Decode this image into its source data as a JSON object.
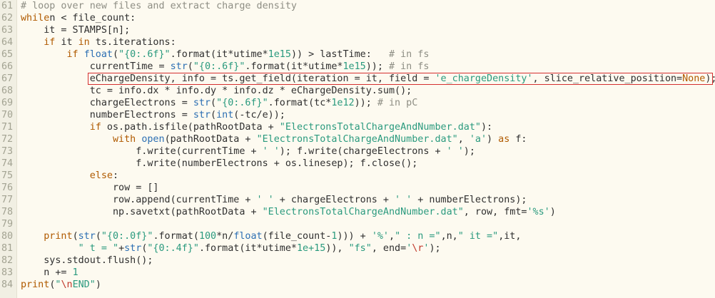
{
  "lines": [
    {
      "n": "61",
      "t": [
        [
          "cm",
          "# loop over new files and extract charge density"
        ]
      ]
    },
    {
      "n": "62",
      "t": [
        [
          "kw",
          "while"
        ],
        [
          "",
          "n < file_count:"
        ]
      ]
    },
    {
      "n": "63",
      "t": [
        [
          "",
          "    it = STAMPS[n];"
        ]
      ]
    },
    {
      "n": "64",
      "t": [
        [
          "",
          "    "
        ],
        [
          "kw",
          "if"
        ],
        [
          "",
          " it "
        ],
        [
          "kw",
          "in"
        ],
        [
          "",
          " ts.iterations:"
        ]
      ]
    },
    {
      "n": "65",
      "t": [
        [
          "",
          "        "
        ],
        [
          "kw",
          "if"
        ],
        [
          "",
          " "
        ],
        [
          "bi",
          "float"
        ],
        [
          "",
          "("
        ],
        [
          "str",
          "\"{0:.6f}\""
        ],
        [
          "",
          ".format(it*utime*"
        ],
        [
          "num",
          "1e15"
        ],
        [
          "",
          "))"
        ],
        [
          "",
          " > lastTime:   "
        ],
        [
          "cm",
          "# in fs"
        ]
      ]
    },
    {
      "n": "66",
      "t": [
        [
          "",
          "            currentTime = "
        ],
        [
          "bi",
          "str"
        ],
        [
          "",
          "("
        ],
        [
          "str",
          "\"{0:.6f}\""
        ],
        [
          "",
          ".format(it*utime*"
        ],
        [
          "num",
          "1e15"
        ],
        [
          "",
          "));"
        ],
        [
          "",
          " "
        ],
        [
          "cm",
          "# in fs"
        ]
      ]
    },
    {
      "n": "67",
      "t": [
        [
          "",
          "            eChargeDensity, info = ts.get_field(iteration = it, field = "
        ],
        [
          "str",
          "'e_chargeDensity'"
        ],
        [
          "",
          ", slice_relative_position="
        ],
        [
          "kw",
          "None"
        ],
        [
          "",
          ");"
        ]
      ],
      "highlight": true
    },
    {
      "n": "68",
      "t": [
        [
          "",
          "            tc = info.dx * info.dy * info.dz * eChargeDensity.sum();"
        ]
      ]
    },
    {
      "n": "69",
      "t": [
        [
          "",
          "            chargeElectrons = "
        ],
        [
          "bi",
          "str"
        ],
        [
          "",
          "("
        ],
        [
          "str",
          "\"{0:.6f}\""
        ],
        [
          "",
          ".format(tc*"
        ],
        [
          "num",
          "1e12"
        ],
        [
          "",
          "));"
        ],
        [
          "",
          " "
        ],
        [
          "cm",
          "# in pC"
        ]
      ]
    },
    {
      "n": "70",
      "t": [
        [
          "",
          "            numberElectrons = "
        ],
        [
          "bi",
          "str"
        ],
        [
          "",
          "("
        ],
        [
          "bi",
          "int"
        ],
        [
          "",
          "(-tc/e));"
        ]
      ]
    },
    {
      "n": "71",
      "t": [
        [
          "",
          "            "
        ],
        [
          "kw",
          "if"
        ],
        [
          "",
          " os.path.isfile(pathRootData + "
        ],
        [
          "str",
          "\"ElectronsTotalChargeAndNumber.dat\""
        ],
        [
          "",
          "):"
        ]
      ]
    },
    {
      "n": "72",
      "t": [
        [
          "",
          "                "
        ],
        [
          "kw",
          "with"
        ],
        [
          "",
          " "
        ],
        [
          "bi",
          "open"
        ],
        [
          "",
          "(pathRootData + "
        ],
        [
          "str",
          "\"ElectronsTotalChargeAndNumber.dat\""
        ],
        [
          "",
          ", "
        ],
        [
          "str",
          "'a'"
        ],
        [
          "",
          ") "
        ],
        [
          "kw",
          "as"
        ],
        [
          "",
          " f:"
        ]
      ]
    },
    {
      "n": "73",
      "t": [
        [
          "",
          "                    f.write(currentTime + "
        ],
        [
          "str",
          "' '"
        ],
        [
          "",
          "); f.write(chargeElectrons + "
        ],
        [
          "str",
          "' '"
        ],
        [
          "",
          ");"
        ]
      ]
    },
    {
      "n": "74",
      "t": [
        [
          "",
          "                    f.write(numberElectrons + os.linesep); f.close();"
        ]
      ]
    },
    {
      "n": "75",
      "t": [
        [
          "",
          "            "
        ],
        [
          "kw",
          "else"
        ],
        [
          "",
          ":"
        ]
      ]
    },
    {
      "n": "76",
      "t": [
        [
          "",
          "                row = []"
        ]
      ]
    },
    {
      "n": "77",
      "t": [
        [
          "",
          "                row.append(currentTime + "
        ],
        [
          "str",
          "' '"
        ],
        [
          "",
          " + chargeElectrons + "
        ],
        [
          "str",
          "' '"
        ],
        [
          "",
          " + numberElectrons);"
        ]
      ]
    },
    {
      "n": "78",
      "t": [
        [
          "",
          "                np.savetxt(pathRootData + "
        ],
        [
          "str",
          "\"ElectronsTotalChargeAndNumber.dat\""
        ],
        [
          "",
          ", row, fmt="
        ],
        [
          "str",
          "'%s'"
        ],
        [
          "",
          ")"
        ]
      ]
    },
    {
      "n": "79",
      "t": []
    },
    {
      "n": "80",
      "t": [
        [
          "",
          "    "
        ],
        [
          "kw",
          "print"
        ],
        [
          "",
          "("
        ],
        [
          "bi",
          "str"
        ],
        [
          "",
          "("
        ],
        [
          "str",
          "\"{0:.0f}\""
        ],
        [
          "",
          ".format("
        ],
        [
          "num",
          "100"
        ],
        [
          "",
          "*n/"
        ],
        [
          "bi",
          "float"
        ],
        [
          "",
          "(file_count-"
        ],
        [
          "num",
          "1"
        ],
        [
          "",
          ")))"
        ],
        [
          "",
          " + "
        ],
        [
          "str",
          "'%'"
        ],
        [
          "",
          ","
        ],
        [
          "str",
          "\" : n =\""
        ],
        [
          "",
          ",n,"
        ],
        [
          "str",
          "\" it =\""
        ],
        [
          "",
          ",it,"
        ]
      ]
    },
    {
      "n": "81",
      "t": [
        [
          "",
          "          "
        ],
        [
          "str",
          "\" t = \""
        ],
        [
          "",
          "+"
        ],
        [
          "bi",
          "str"
        ],
        [
          "",
          "("
        ],
        [
          "str",
          "\"{0:.4f}\""
        ],
        [
          "",
          ".format(it*utime*"
        ],
        [
          "num",
          "1e+15"
        ],
        [
          "",
          ")), "
        ],
        [
          "str",
          "\"fs\""
        ],
        [
          "",
          ", end="
        ],
        [
          "str",
          "'"
        ],
        [
          "esc",
          "\\r"
        ],
        [
          "str",
          "'"
        ],
        [
          "",
          ");"
        ]
      ]
    },
    {
      "n": "82",
      "t": [
        [
          "",
          "    sys.stdout.flush();"
        ]
      ]
    },
    {
      "n": "83",
      "t": [
        [
          "",
          "    n += "
        ],
        [
          "num",
          "1"
        ]
      ]
    },
    {
      "n": "84",
      "t": [
        [
          "kw",
          "print"
        ],
        [
          "",
          "("
        ],
        [
          "str",
          "\""
        ],
        [
          "esc",
          "\\n"
        ],
        [
          "str",
          "END\""
        ],
        [
          "",
          ")"
        ]
      ]
    }
  ]
}
